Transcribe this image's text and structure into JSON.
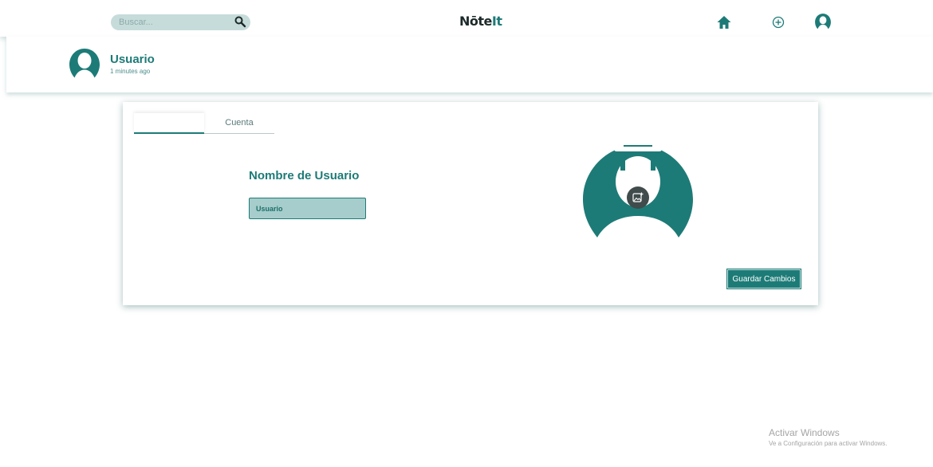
{
  "header": {
    "search": {
      "placeholder": "Buscar...",
      "icon": "search-icon"
    },
    "logo": {
      "main": "Nōte",
      "accent": "It"
    },
    "nav": [
      "home-icon",
      "add-circle-icon",
      "user-icon"
    ]
  },
  "profile": {
    "name": "Usuario",
    "timestamp": "1 minutes ago",
    "icon": "user-avatar-icon"
  },
  "card": {
    "tabs": [
      {
        "label": ""
      },
      {
        "label": "Cuenta"
      }
    ],
    "username_label": "Nombre de Usuario",
    "username_value": "Usuario",
    "photo_button_icon": "add-photo-icon",
    "save_label": "Guardar Cambios"
  },
  "watermark": {
    "title": "Activar Windows",
    "subtitle": "Ve a Configuración para activar Windows."
  },
  "colors": {
    "accent": "#1d7b77",
    "input_bg": "#a6cdcb",
    "search_bg": "#c6dcdb"
  }
}
